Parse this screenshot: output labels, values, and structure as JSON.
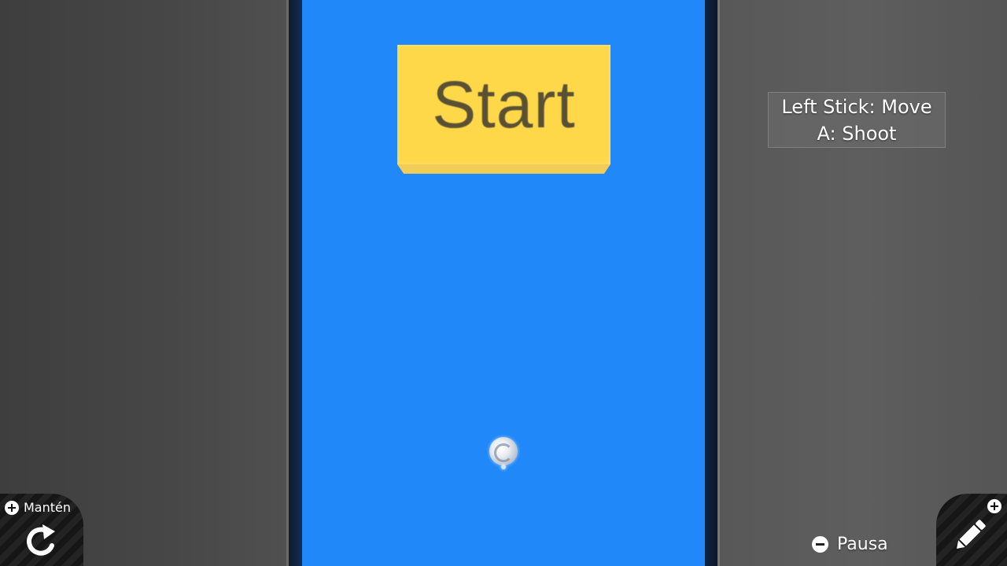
{
  "game": {
    "start_label": "Start",
    "controls_hint": {
      "line1": "Left Stick: Move",
      "line2": "A: Shoot"
    }
  },
  "system": {
    "hold_label": "Mantén",
    "pause_label": "Pausa"
  },
  "icons": {
    "hold": "plus-icon",
    "reset": "rotate-arrow-icon",
    "pause": "minus-icon",
    "edit": "pencil-icon",
    "edit_badge": "plus-icon"
  },
  "colors": {
    "playfield": "#2088f8",
    "start_button": "#ffd84a",
    "start_text": "#5a5034",
    "side_panels": "#4a4a4a"
  }
}
